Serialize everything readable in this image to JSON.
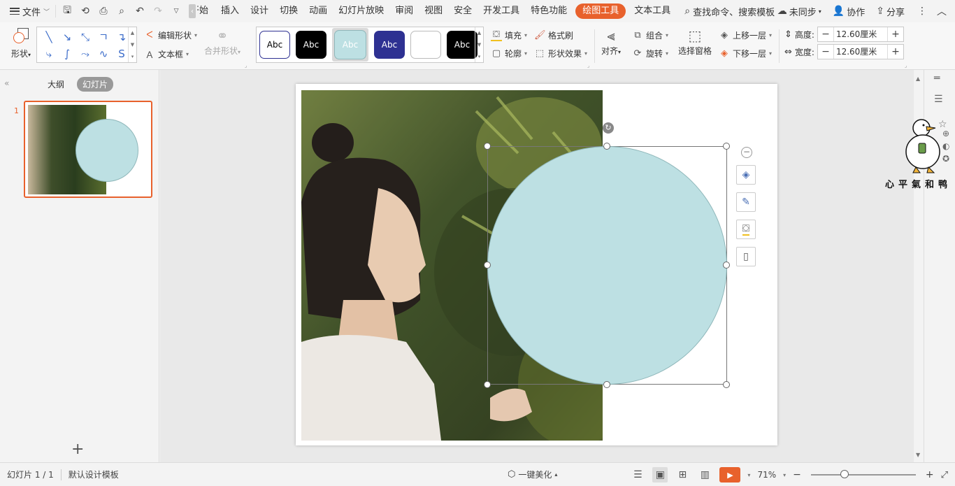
{
  "menubar": {
    "file_label": "文件",
    "tabs": [
      {
        "label": "开始"
      },
      {
        "label": "插入"
      },
      {
        "label": "设计"
      },
      {
        "label": "切换"
      },
      {
        "label": "动画"
      },
      {
        "label": "幻灯片放映"
      },
      {
        "label": "审阅"
      },
      {
        "label": "视图"
      },
      {
        "label": "安全"
      },
      {
        "label": "开发工具"
      },
      {
        "label": "特色功能"
      },
      {
        "label": "绘图工具"
      },
      {
        "label": "文本工具"
      }
    ],
    "search_label": "查找命令、搜索模板",
    "sync_label": "未同步",
    "collab_label": "协作",
    "share_label": "分享"
  },
  "ribbon": {
    "shape_label": "形状",
    "edit_shape_label": "编辑形状",
    "textbox_label": "文本框",
    "merge_shape_label": "合并形状",
    "style_samples": [
      {
        "label": "Abc"
      },
      {
        "label": "Abc"
      },
      {
        "label": "Abc"
      },
      {
        "label": "Abc"
      },
      {
        "label": ""
      },
      {
        "label": "Abc"
      }
    ],
    "fill_label": "填充",
    "format_brush_label": "格式刷",
    "outline_label": "轮廓",
    "shape_effect_label": "形状效果",
    "align_label": "对齐",
    "group_label": "组合",
    "rotate_label": "旋转",
    "select_pane_label": "选择窗格",
    "bring_forward_label": "上移一层",
    "send_backward_label": "下移一层",
    "height_label": "高度:",
    "height_value": "12.60厘米",
    "width_label": "宽度:",
    "width_value": "12.60厘米"
  },
  "leftpanel": {
    "outline_tab": "大纲",
    "slides_tab": "幻灯片",
    "slide_number": "1"
  },
  "watermark": {
    "text": "心平氣和鸭"
  },
  "statusbar": {
    "slide_count": "幻灯片 1 / 1",
    "template": "默认设计模板",
    "beautify": "一键美化",
    "zoom": "71%"
  },
  "colors": {
    "accent": "#e8612c",
    "shape_fill": "#bde0e3",
    "style_dark_blue": "#2e3192"
  }
}
